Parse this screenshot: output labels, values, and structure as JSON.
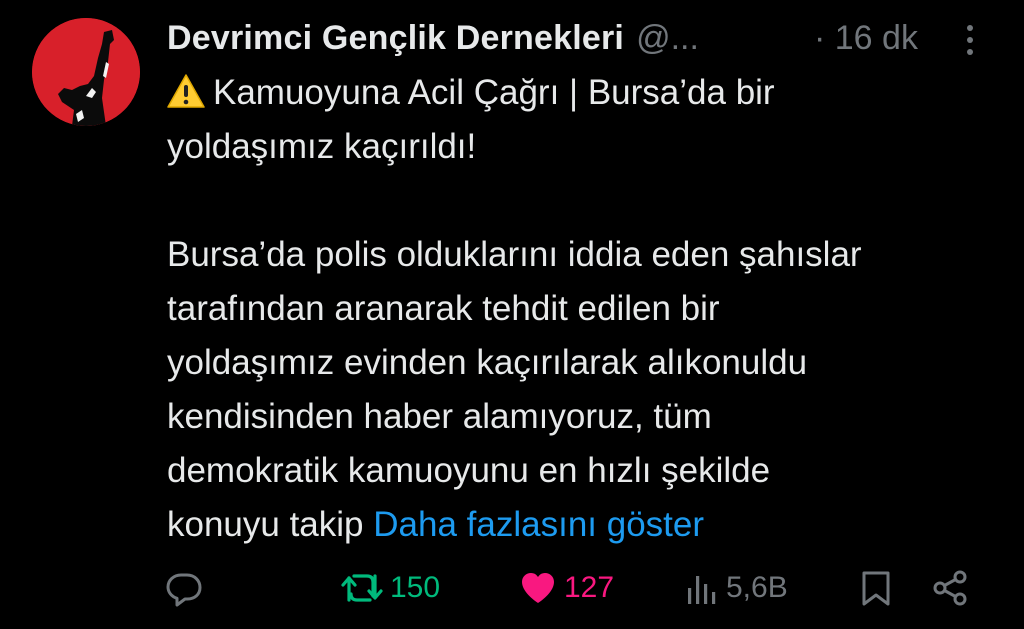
{
  "author": {
    "display_name": "Devrimci Gençlik Dernekleri",
    "handle": "@...",
    "avatar_icon": "raised-fist-figure-icon",
    "avatar_color": "#d8202a"
  },
  "meta": {
    "timestamp": "· 16 dk",
    "more_icon": "more-vertical-icon"
  },
  "tweet": {
    "warning_icon": "warning-triangle-emoji",
    "lines": [
      "Kamuoyuna Acil Çağrı | Bursa’da bir",
      "yoldaşımız kaçırıldı!",
      "Bursa’da polis olduklarını iddia eden şahıslar",
      "tarafından aranarak tehdit edilen bir",
      "yoldaşımız evinden kaçırılarak alıkonuldu",
      "kendisinden haber alamıyoruz, tüm",
      "demokratik kamuoyunu en hızlı şekilde",
      "konuyu takip"
    ],
    "show_more": "Daha fazlasını göster",
    "link_color": "#1d9bf0"
  },
  "actions": {
    "reply_icon": "reply-icon",
    "retweet_icon": "retweet-icon",
    "retweet_count": "150",
    "retweet_color": "#00ba7c",
    "like_icon": "heart-filled-icon",
    "like_count": "127",
    "like_color": "#f91880",
    "views_icon": "views-chart-icon",
    "views_count": "5,6B",
    "bookmark_icon": "bookmark-icon",
    "share_icon": "share-icon"
  }
}
